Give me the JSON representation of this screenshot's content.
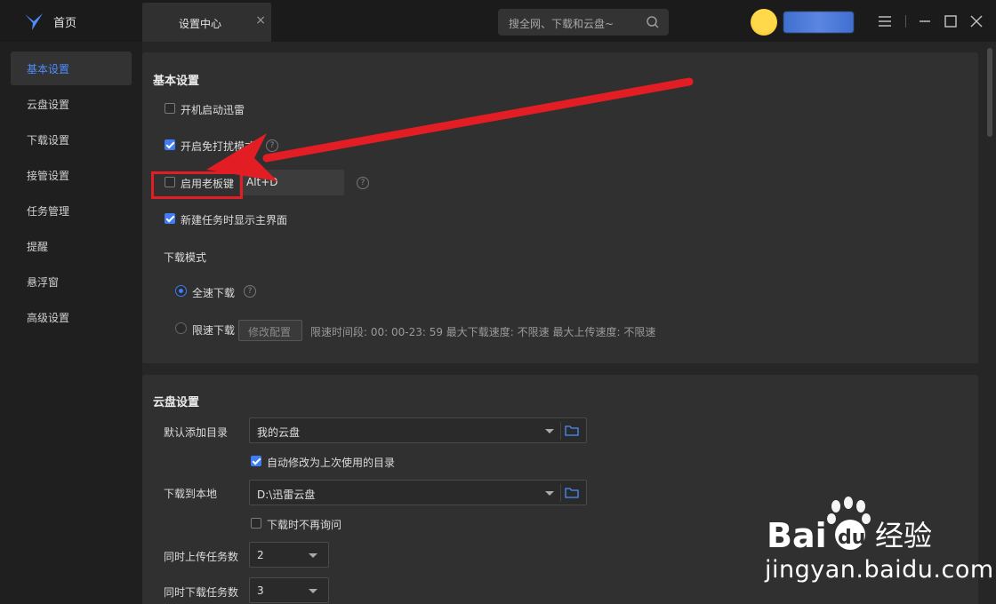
{
  "titlebar": {
    "home_label": "首页",
    "tab_label": "设置中心",
    "tab_close": "×",
    "search_placeholder": "搜全网、下载和云盘~"
  },
  "sidebar": {
    "items": [
      {
        "label": "基本设置",
        "active": true
      },
      {
        "label": "云盘设置"
      },
      {
        "label": "下载设置"
      },
      {
        "label": "接管设置"
      },
      {
        "label": "任务管理"
      },
      {
        "label": "提醒"
      },
      {
        "label": "悬浮窗"
      },
      {
        "label": "高级设置"
      }
    ]
  },
  "basic": {
    "title": "基本设置",
    "autostart": {
      "label": "开机启动迅雷",
      "checked": false
    },
    "nodisturb": {
      "label": "开启免打扰模式",
      "checked": true
    },
    "bosskey": {
      "label": "启用老板键",
      "checked": false,
      "hotkey": "Alt+D"
    },
    "showmain": {
      "label": "新建任务时显示主界面",
      "checked": true
    },
    "download_mode": {
      "label": "下载模式",
      "full": {
        "label": "全速下载",
        "selected": true
      },
      "limited": {
        "label": "限速下载",
        "selected": false
      },
      "modify_button": "修改配置",
      "limit_info": "限速时间段:   00: 00-23: 59   最大下载速度: 不限速    最大上传速度: 不限速"
    }
  },
  "cloud": {
    "title": "云盘设置",
    "default_dir_label": "默认添加目录",
    "default_dir_value": "我的云盘",
    "auto_modify": {
      "label": "自动修改为上次使用的目录",
      "checked": true
    },
    "local_label": "下载到本地",
    "local_value": "D:\\迅雷云盘",
    "no_ask": {
      "label": "下载时不再询问",
      "checked": false
    },
    "upload_tasks_label": "同时上传任务数",
    "upload_tasks_value": "2",
    "download_tasks_label": "同时下载任务数",
    "download_tasks_value": "3"
  },
  "watermark": {
    "brand": "Baidu经验",
    "url": "jingyan.baidu.com"
  },
  "colors": {
    "accent": "#3f7cf5",
    "annotation": "#e21d24"
  }
}
